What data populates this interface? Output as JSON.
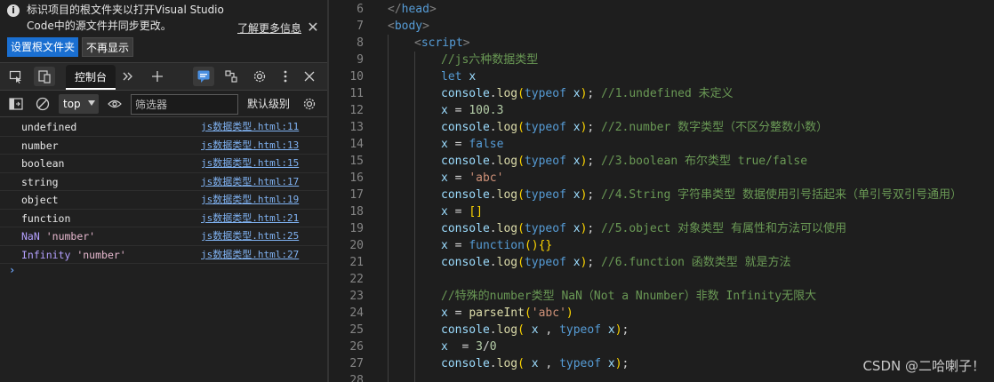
{
  "banner": {
    "message": "标识项目的根文件夹以打开Visual Studio Code中的源文件并同步更改。",
    "learn_more": "了解更多信息",
    "set_root_button": "设置根文件夹",
    "dont_show_button": "不再显示"
  },
  "tabs": {
    "console_label": "控制台"
  },
  "filterbar": {
    "context": "top",
    "filter_placeholder": "筛选器",
    "levels_label": "默认级别"
  },
  "console_rows": [
    {
      "message": "undefined",
      "source": "js数据类型.html:11"
    },
    {
      "message": "number",
      "source": "js数据类型.html:13"
    },
    {
      "message": "boolean",
      "source": "js数据类型.html:15"
    },
    {
      "message": "string",
      "source": "js数据类型.html:17"
    },
    {
      "message": "object",
      "source": "js数据类型.html:19"
    },
    {
      "message": "function",
      "source": "js数据类型.html:21"
    },
    {
      "message_name": "NaN",
      "message_str": "'number'",
      "source": "js数据类型.html:25"
    },
    {
      "message_name": "Infinity",
      "message_str": "'number'",
      "source": "js数据类型.html:27"
    }
  ],
  "prompt_symbol": "›",
  "editor": {
    "lines": [
      {
        "n": "6",
        "indent": 1,
        "tokens": [
          [
            "t-punc",
            "</"
          ],
          [
            "t-tag",
            "head"
          ],
          [
            "t-punc",
            ">"
          ]
        ]
      },
      {
        "n": "7",
        "indent": 1,
        "tokens": [
          [
            "t-punc",
            "<"
          ],
          [
            "t-tag",
            "body"
          ],
          [
            "t-punc",
            ">"
          ]
        ]
      },
      {
        "n": "8",
        "indent": 2,
        "tokens": [
          [
            "t-punc",
            "<"
          ],
          [
            "t-tag",
            "script"
          ],
          [
            "t-punc",
            ">"
          ]
        ]
      },
      {
        "n": "9",
        "indent": 3,
        "tokens": [
          [
            "t-comment",
            "//js六种数据类型"
          ]
        ]
      },
      {
        "n": "10",
        "indent": 3,
        "tokens": [
          [
            "t-kw",
            "let "
          ],
          [
            "t-var",
            "x"
          ]
        ]
      },
      {
        "n": "11",
        "indent": 3,
        "tokens": [
          [
            "t-var",
            "console"
          ],
          [
            "t-plain",
            "."
          ],
          [
            "t-fn",
            "log"
          ],
          [
            "t-paren",
            "("
          ],
          [
            "t-kw",
            "typeof "
          ],
          [
            "t-var",
            "x"
          ],
          [
            "t-paren",
            ")"
          ],
          [
            "t-plain",
            "; "
          ],
          [
            "t-comment",
            "//1.undefined 未定义"
          ]
        ]
      },
      {
        "n": "12",
        "indent": 3,
        "tokens": [
          [
            "t-var",
            "x"
          ],
          [
            "t-plain",
            " = "
          ],
          [
            "t-num",
            "100.3"
          ]
        ]
      },
      {
        "n": "13",
        "indent": 3,
        "tokens": [
          [
            "t-var",
            "console"
          ],
          [
            "t-plain",
            "."
          ],
          [
            "t-fn",
            "log"
          ],
          [
            "t-paren",
            "("
          ],
          [
            "t-kw",
            "typeof "
          ],
          [
            "t-var",
            "x"
          ],
          [
            "t-paren",
            ")"
          ],
          [
            "t-plain",
            "; "
          ],
          [
            "t-comment",
            "//2.number 数字类型（不区分整数小数）"
          ]
        ]
      },
      {
        "n": "14",
        "indent": 3,
        "tokens": [
          [
            "t-var",
            "x"
          ],
          [
            "t-plain",
            " = "
          ],
          [
            "t-kw",
            "false"
          ]
        ]
      },
      {
        "n": "15",
        "indent": 3,
        "tokens": [
          [
            "t-var",
            "console"
          ],
          [
            "t-plain",
            "."
          ],
          [
            "t-fn",
            "log"
          ],
          [
            "t-paren",
            "("
          ],
          [
            "t-kw",
            "typeof "
          ],
          [
            "t-var",
            "x"
          ],
          [
            "t-paren",
            ")"
          ],
          [
            "t-plain",
            "; "
          ],
          [
            "t-comment",
            "//3.boolean 布尔类型 true/false"
          ]
        ]
      },
      {
        "n": "16",
        "indent": 3,
        "tokens": [
          [
            "t-var",
            "x"
          ],
          [
            "t-plain",
            " = "
          ],
          [
            "t-str",
            "'abc'"
          ]
        ]
      },
      {
        "n": "17",
        "indent": 3,
        "tokens": [
          [
            "t-var",
            "console"
          ],
          [
            "t-plain",
            "."
          ],
          [
            "t-fn",
            "log"
          ],
          [
            "t-paren",
            "("
          ],
          [
            "t-kw",
            "typeof "
          ],
          [
            "t-var",
            "x"
          ],
          [
            "t-paren",
            ")"
          ],
          [
            "t-plain",
            "; "
          ],
          [
            "t-comment",
            "//4.String 字符串类型 数据使用引号括起来（单引号双引号通用）"
          ]
        ]
      },
      {
        "n": "18",
        "indent": 3,
        "tokens": [
          [
            "t-var",
            "x"
          ],
          [
            "t-plain",
            " = "
          ],
          [
            "t-paren",
            "[]"
          ]
        ]
      },
      {
        "n": "19",
        "indent": 3,
        "tokens": [
          [
            "t-var",
            "console"
          ],
          [
            "t-plain",
            "."
          ],
          [
            "t-fn",
            "log"
          ],
          [
            "t-paren",
            "("
          ],
          [
            "t-kw",
            "typeof "
          ],
          [
            "t-var",
            "x"
          ],
          [
            "t-paren",
            ")"
          ],
          [
            "t-plain",
            "; "
          ],
          [
            "t-comment",
            "//5.object 对象类型 有属性和方法可以使用"
          ]
        ]
      },
      {
        "n": "20",
        "indent": 3,
        "tokens": [
          [
            "t-var",
            "x"
          ],
          [
            "t-plain",
            " = "
          ],
          [
            "t-kw",
            "function"
          ],
          [
            "t-paren",
            "(){}"
          ]
        ]
      },
      {
        "n": "21",
        "indent": 3,
        "tokens": [
          [
            "t-var",
            "console"
          ],
          [
            "t-plain",
            "."
          ],
          [
            "t-fn",
            "log"
          ],
          [
            "t-paren",
            "("
          ],
          [
            "t-kw",
            "typeof "
          ],
          [
            "t-var",
            "x"
          ],
          [
            "t-paren",
            ")"
          ],
          [
            "t-plain",
            "; "
          ],
          [
            "t-comment",
            "//6.function 函数类型 就是方法"
          ]
        ]
      },
      {
        "n": "22",
        "indent": 3,
        "tokens": []
      },
      {
        "n": "23",
        "indent": 3,
        "tokens": [
          [
            "t-comment",
            "//特殊的number类型 NaN（Not a Nnumber）非数 Infinity无限大"
          ]
        ]
      },
      {
        "n": "24",
        "indent": 3,
        "tokens": [
          [
            "t-var",
            "x"
          ],
          [
            "t-plain",
            " = "
          ],
          [
            "t-fn",
            "parseInt"
          ],
          [
            "t-paren",
            "("
          ],
          [
            "t-str",
            "'abc'"
          ],
          [
            "t-paren",
            ")"
          ]
        ]
      },
      {
        "n": "25",
        "indent": 3,
        "tokens": [
          [
            "t-var",
            "console"
          ],
          [
            "t-plain",
            "."
          ],
          [
            "t-fn",
            "log"
          ],
          [
            "t-paren",
            "("
          ],
          [
            "t-plain",
            " "
          ],
          [
            "t-var",
            "x"
          ],
          [
            "t-plain",
            " , "
          ],
          [
            "t-kw",
            "typeof "
          ],
          [
            "t-var",
            "x"
          ],
          [
            "t-paren",
            ")"
          ],
          [
            "t-plain",
            ";"
          ]
        ]
      },
      {
        "n": "26",
        "indent": 3,
        "tokens": [
          [
            "t-var",
            "x"
          ],
          [
            "t-plain",
            "  = "
          ],
          [
            "t-num",
            "3"
          ],
          [
            "t-plain",
            "/"
          ],
          [
            "t-num",
            "0"
          ]
        ]
      },
      {
        "n": "27",
        "indent": 3,
        "tokens": [
          [
            "t-var",
            "console"
          ],
          [
            "t-plain",
            "."
          ],
          [
            "t-fn",
            "log"
          ],
          [
            "t-paren",
            "("
          ],
          [
            "t-plain",
            " "
          ],
          [
            "t-var",
            "x"
          ],
          [
            "t-plain",
            " , "
          ],
          [
            "t-kw",
            "typeof "
          ],
          [
            "t-var",
            "x"
          ],
          [
            "t-paren",
            ")"
          ],
          [
            "t-plain",
            ";"
          ]
        ]
      },
      {
        "n": "28",
        "indent": 3,
        "tokens": []
      }
    ]
  },
  "watermark": "CSDN @二哈喇子！"
}
